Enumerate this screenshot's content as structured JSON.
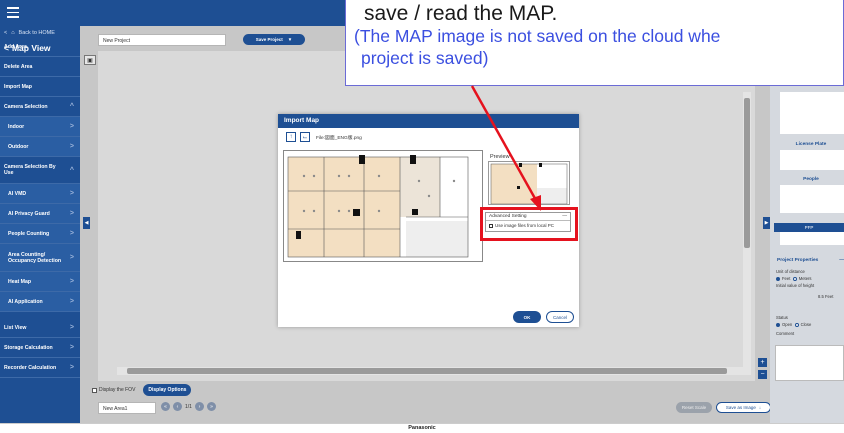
{
  "sidebar": {
    "back_label": "Back to HOME",
    "title": "Map View",
    "items": [
      {
        "label": "Add Area",
        "chev": "",
        "sub": false
      },
      {
        "label": "Delete Area",
        "chev": "",
        "sub": false
      },
      {
        "label": "Import Map",
        "chev": "",
        "sub": false
      },
      {
        "label": "Camera Selection",
        "chev": "^",
        "sub": false
      },
      {
        "label": "Indoor",
        "chev": ">",
        "sub": true
      },
      {
        "label": "Outdoor",
        "chev": ">",
        "sub": true
      },
      {
        "label": "Camera Selection By Use",
        "chev": "^",
        "sub": false
      },
      {
        "label": "AI VMD",
        "chev": ">",
        "sub": true
      },
      {
        "label": "AI Privacy Guard",
        "chev": ">",
        "sub": true
      },
      {
        "label": "People Counting",
        "chev": ">",
        "sub": true
      },
      {
        "label": "Area Counting/ Occupancy Detection",
        "chev": ">",
        "sub": true
      },
      {
        "label": "Heat Map",
        "chev": ">",
        "sub": true
      },
      {
        "label": "AI Application",
        "chev": ">",
        "sub": true
      },
      {
        "label": "List View",
        "chev": ">",
        "sub": false
      },
      {
        "label": "Storage Calculation",
        "chev": ">",
        "sub": false
      },
      {
        "label": "Recorder Calculation",
        "chev": ">",
        "sub": false
      }
    ]
  },
  "toolbar": {
    "project_name": "New Project",
    "save_project_label": "Save Project"
  },
  "bottom": {
    "display_fov_label": "Display the FOV",
    "display_options_label": "Display Options",
    "area_name": "New Area1",
    "page_indicator": "1/1",
    "reset_scale_label": "Reset Scale",
    "save_image_label": "Save as Image"
  },
  "footer": {
    "brand": "Panasonic"
  },
  "right_panel": {
    "license_plate_label": "License Plate",
    "people_label": "People",
    "pfp_label": "PFP",
    "project_properties_label": "Project Properties",
    "unit_of_distance_label": "Unit of distance",
    "unit_feet": "Feet",
    "unit_meters": "Meters",
    "initial_height_label": "Initial value of height",
    "height_value": "8.5",
    "height_unit": "Feet",
    "status_label": "Status",
    "status_open": "Open",
    "status_close": "Close",
    "comment_label": "Comment"
  },
  "callout": {
    "line1": "save / read the MAP.",
    "line2": "(The MAP image is not saved on the cloud whe",
    "line3": "project is saved)"
  },
  "dialog": {
    "title": "Import Map",
    "file_label": "File:図面_ENG版.png",
    "preview_label": "Preview",
    "advanced_label": "Advanced Setting",
    "advanced_collapse": "—",
    "use_local_label": "Use image files from local PC",
    "ok_label": "OK",
    "cancel_label": "Cancel"
  },
  "colors": {
    "primary": "#1e4f93",
    "highlight_red": "#e5121e",
    "callout_blue": "#3b4fe0"
  }
}
